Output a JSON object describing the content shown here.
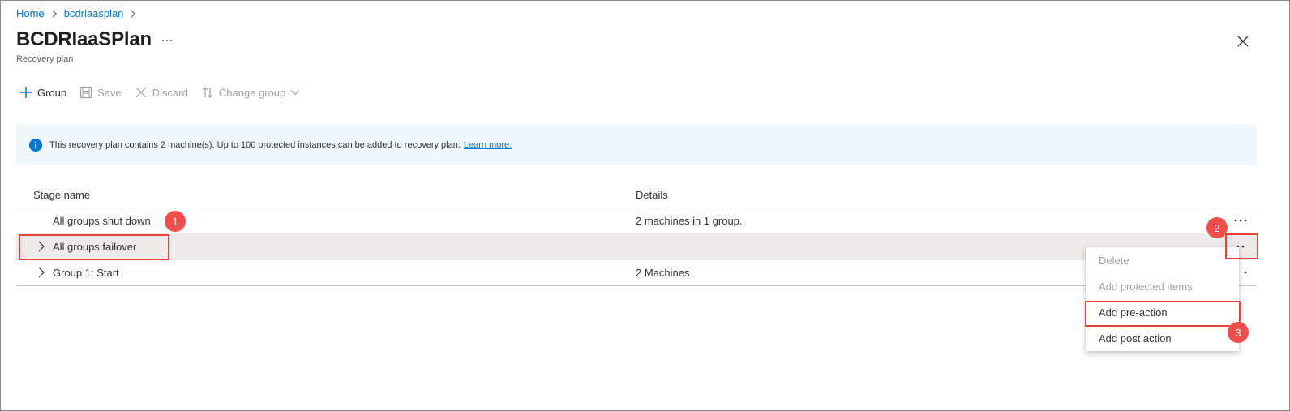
{
  "breadcrumb": {
    "items": [
      {
        "label": "Home"
      },
      {
        "label": "bcdriaasplan"
      }
    ]
  },
  "header": {
    "title": "BCDRIaaSPlan",
    "more_label": "···",
    "subtitle": "Recovery plan"
  },
  "toolbar": {
    "group_label": "Group",
    "save_label": "Save",
    "discard_label": "Discard",
    "change_group_label": "Change group"
  },
  "info": {
    "text": "This recovery plan contains 2 machine(s). Up to 100 protected instances can be added to recovery plan.",
    "link": "Learn more."
  },
  "table": {
    "headers": {
      "stage": "Stage name",
      "details": "Details"
    },
    "rows": [
      {
        "name": "All groups shut down",
        "details": "2 machines in 1 group.",
        "expandable": false
      },
      {
        "name": "All groups failover",
        "details": "",
        "expandable": true,
        "selected": true
      },
      {
        "name": "Group 1: Start",
        "details": "2 Machines",
        "expandable": true
      }
    ]
  },
  "context_menu": {
    "items": [
      {
        "label": "Delete",
        "enabled": false
      },
      {
        "label": "Add protected items",
        "enabled": false
      },
      {
        "label": "Add pre-action",
        "enabled": true
      },
      {
        "label": "Add post action",
        "enabled": true
      }
    ]
  },
  "annotations": {
    "badges": [
      "1",
      "2",
      "3"
    ],
    "color": "#e8403b"
  },
  "colors": {
    "accent": "#0078d4",
    "info_bg": "#eff6fc",
    "selected_row": "#edebe9"
  }
}
